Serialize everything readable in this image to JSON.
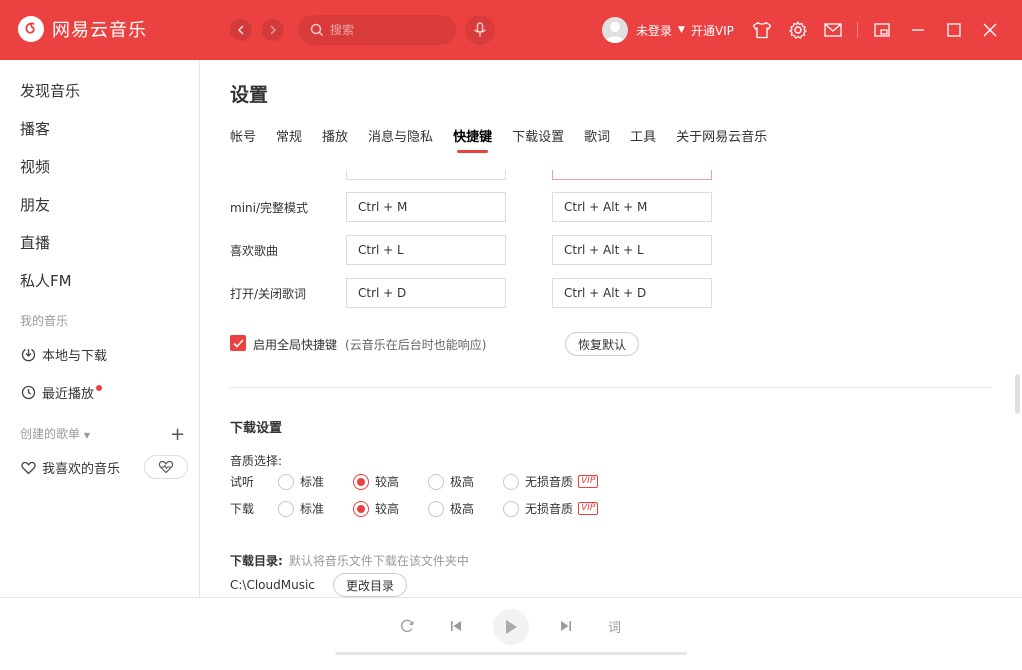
{
  "app": {
    "name": "网易云音乐",
    "brand_color": "#ec4141"
  },
  "header": {
    "search_placeholder": "搜索",
    "user_name": "未登录",
    "vip_link": "开通VIP",
    "icons": [
      "back-icon",
      "forward-icon",
      "mic-icon",
      "shirt-icon",
      "gear-icon",
      "mail-icon",
      "mini-mode-icon",
      "minimize-icon",
      "maximize-icon",
      "close-icon"
    ]
  },
  "sidebar": {
    "items": [
      "发现音乐",
      "播客",
      "视频",
      "朋友",
      "直播",
      "私人FM"
    ],
    "my_music_label": "我的音乐",
    "my_music": [
      {
        "label": "本地与下载",
        "icon": "download-icon"
      },
      {
        "label": "最近播放",
        "icon": "clock-icon"
      }
    ],
    "playlists_label": "创建的歌单",
    "playlists": [
      {
        "label": "我喜欢的音乐",
        "icon": "heart-icon"
      }
    ]
  },
  "settings": {
    "title": "设置",
    "tabs": [
      "帐号",
      "常规",
      "播放",
      "消息与隐私",
      "快捷键",
      "下载设置",
      "歌词",
      "工具",
      "关于网易云音乐"
    ],
    "active_tab": "快捷键",
    "shortcuts": [
      {
        "label": "mini/完整模式",
        "local": "Ctrl + M",
        "global": "Ctrl + Alt + M"
      },
      {
        "label": "喜欢歌曲",
        "local": "Ctrl + L",
        "global": "Ctrl + Alt + L"
      },
      {
        "label": "打开/关闭歌词",
        "local": "Ctrl + D",
        "global": "Ctrl + Alt + D"
      }
    ],
    "global_checkbox": {
      "label": "启用全局快捷键",
      "hint": "(云音乐在后台时也能响应)",
      "checked": true
    },
    "reset_button": "恢复默认",
    "download": {
      "title": "下载设置",
      "quality_label": "音质选择:",
      "rows": [
        {
          "label": "试听",
          "selected": "较高"
        },
        {
          "label": "下载",
          "selected": "较高"
        }
      ],
      "options": [
        "标准",
        "较高",
        "极高",
        "无损音质"
      ],
      "vip_badge": "VIP",
      "dir_label": "下载目录:",
      "dir_hint": "默认将音乐文件下载在该文件夹中",
      "dir_path": "C:\\CloudMusic",
      "change_button": "更改目录"
    }
  },
  "player": {
    "lyric_button": "词"
  }
}
